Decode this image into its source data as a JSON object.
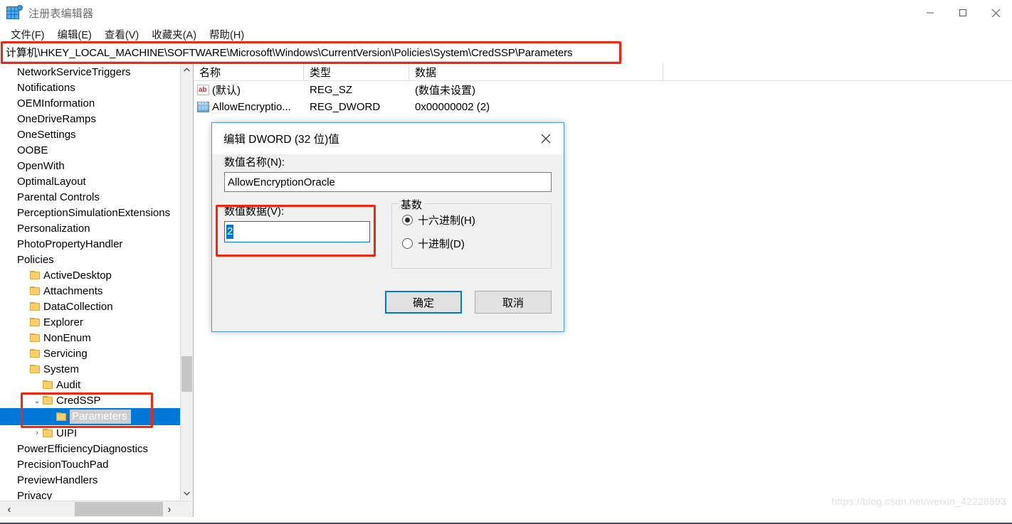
{
  "window": {
    "title": "注册表编辑器",
    "icon": "registry-editor-icon",
    "minimize": "—",
    "maximize": "□",
    "close": "✕"
  },
  "menubar": [
    {
      "label": "文件(F)"
    },
    {
      "label": "编辑(E)"
    },
    {
      "label": "查看(V)"
    },
    {
      "label": "收藏夹(A)"
    },
    {
      "label": "帮助(H)"
    }
  ],
  "address": {
    "path": "计算机\\HKEY_LOCAL_MACHINE\\SOFTWARE\\Microsoft\\Windows\\CurrentVersion\\Policies\\System\\CredSSP\\Parameters"
  },
  "tree": {
    "items": [
      {
        "label": "NetworkServiceTriggers",
        "depth": 0,
        "folder": false,
        "chevron": "",
        "selected": false
      },
      {
        "label": "Notifications",
        "depth": 0,
        "folder": false,
        "chevron": "",
        "selected": false
      },
      {
        "label": "OEMInformation",
        "depth": 0,
        "folder": false,
        "chevron": "",
        "selected": false
      },
      {
        "label": "OneDriveRamps",
        "depth": 0,
        "folder": false,
        "chevron": "",
        "selected": false
      },
      {
        "label": "OneSettings",
        "depth": 0,
        "folder": false,
        "chevron": "",
        "selected": false
      },
      {
        "label": "OOBE",
        "depth": 0,
        "folder": false,
        "chevron": "",
        "selected": false
      },
      {
        "label": "OpenWith",
        "depth": 0,
        "folder": false,
        "chevron": "",
        "selected": false
      },
      {
        "label": "OptimalLayout",
        "depth": 0,
        "folder": false,
        "chevron": "",
        "selected": false
      },
      {
        "label": "Parental Controls",
        "depth": 0,
        "folder": false,
        "chevron": "",
        "selected": false
      },
      {
        "label": "PerceptionSimulationExtensions",
        "depth": 0,
        "folder": false,
        "chevron": "",
        "selected": false
      },
      {
        "label": "Personalization",
        "depth": 0,
        "folder": false,
        "chevron": "",
        "selected": false
      },
      {
        "label": "PhotoPropertyHandler",
        "depth": 0,
        "folder": false,
        "chevron": "",
        "selected": false
      },
      {
        "label": "Policies",
        "depth": 0,
        "folder": false,
        "chevron": "",
        "selected": false
      },
      {
        "label": "ActiveDesktop",
        "depth": 1,
        "folder": true,
        "chevron": "",
        "selected": false
      },
      {
        "label": "Attachments",
        "depth": 1,
        "folder": true,
        "chevron": "",
        "selected": false
      },
      {
        "label": "DataCollection",
        "depth": 1,
        "folder": true,
        "chevron": "",
        "selected": false
      },
      {
        "label": "Explorer",
        "depth": 1,
        "folder": true,
        "chevron": "",
        "selected": false
      },
      {
        "label": "NonEnum",
        "depth": 1,
        "folder": true,
        "chevron": "",
        "selected": false
      },
      {
        "label": "Servicing",
        "depth": 1,
        "folder": true,
        "chevron": "",
        "selected": false
      },
      {
        "label": "System",
        "depth": 1,
        "folder": true,
        "chevron": "",
        "selected": false
      },
      {
        "label": "Audit",
        "depth": 2,
        "folder": true,
        "chevron": "",
        "selected": false
      },
      {
        "label": "CredSSP",
        "depth": 2,
        "folder": true,
        "chevron": "⌄",
        "selected": false
      },
      {
        "label": "Parameters",
        "depth": 3,
        "folder": true,
        "chevron": "",
        "selected": true
      },
      {
        "label": "UIPI",
        "depth": 2,
        "folder": true,
        "chevron": "›",
        "selected": false
      },
      {
        "label": "PowerEfficiencyDiagnostics",
        "depth": 0,
        "folder": false,
        "chevron": "",
        "selected": false
      },
      {
        "label": "PrecisionTouchPad",
        "depth": 0,
        "folder": false,
        "chevron": "",
        "selected": false
      },
      {
        "label": "PreviewHandlers",
        "depth": 0,
        "folder": false,
        "chevron": "",
        "selected": false
      },
      {
        "label": "Privacy",
        "depth": 0,
        "folder": false,
        "chevron": "",
        "selected": false
      }
    ],
    "scroll_up_icon": "chevron-up-icon",
    "scroll_down_icon": "chevron-down-icon",
    "scroll_left_icon": "‹",
    "scroll_right_icon": "›"
  },
  "list": {
    "columns": [
      "名称",
      "类型",
      "数据"
    ],
    "rows": [
      {
        "icon": "string-value-icon",
        "name": "(默认)",
        "type": "REG_SZ",
        "data": "(数值未设置)"
      },
      {
        "icon": "dword-value-icon",
        "name": "AllowEncryptio...",
        "type": "REG_DWORD",
        "data": "0x00000002 (2)"
      }
    ]
  },
  "dialog": {
    "title": "编辑 DWORD (32 位)值",
    "close_icon": "close-icon",
    "name_label": "数值名称(N):",
    "name_value": "AllowEncryptionOracle",
    "data_label": "数值数据(V):",
    "data_value": "2",
    "base_group_label": "基数",
    "radios": [
      {
        "label": "十六进制(H)",
        "checked": true
      },
      {
        "label": "十进制(D)",
        "checked": false
      }
    ],
    "ok_label": "确定",
    "cancel_label": "取消"
  },
  "watermark": "https://blog.csdn.net/weixin_42228893",
  "colors": {
    "accent": "#0078d7",
    "annotation": "#f22613",
    "selection": "#cdcdcd",
    "folder": "#f7cf6b"
  }
}
